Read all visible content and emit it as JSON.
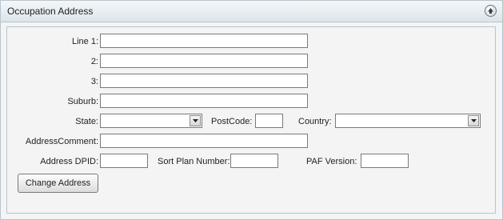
{
  "panel": {
    "title": "Occupation Address",
    "collapse_icon": "chevron-up-circle-icon"
  },
  "form": {
    "line1": {
      "label": "Line 1:",
      "value": ""
    },
    "line2": {
      "label": "2:",
      "value": ""
    },
    "line3": {
      "label": "3:",
      "value": ""
    },
    "suburb": {
      "label": "Suburb:",
      "value": ""
    },
    "state": {
      "label": "State:",
      "value": ""
    },
    "postcode": {
      "label": "PostCode:",
      "value": ""
    },
    "country": {
      "label": "Country:",
      "value": ""
    },
    "address_comment": {
      "label": "AddressComment:",
      "value": ""
    },
    "address_dpid": {
      "label": "Address DPID:",
      "value": ""
    },
    "sort_plan_number": {
      "label": "Sort Plan Number:",
      "value": ""
    },
    "paf_version": {
      "label": "PAF Version:",
      "value": ""
    },
    "change_address_button": "Change Address"
  }
}
